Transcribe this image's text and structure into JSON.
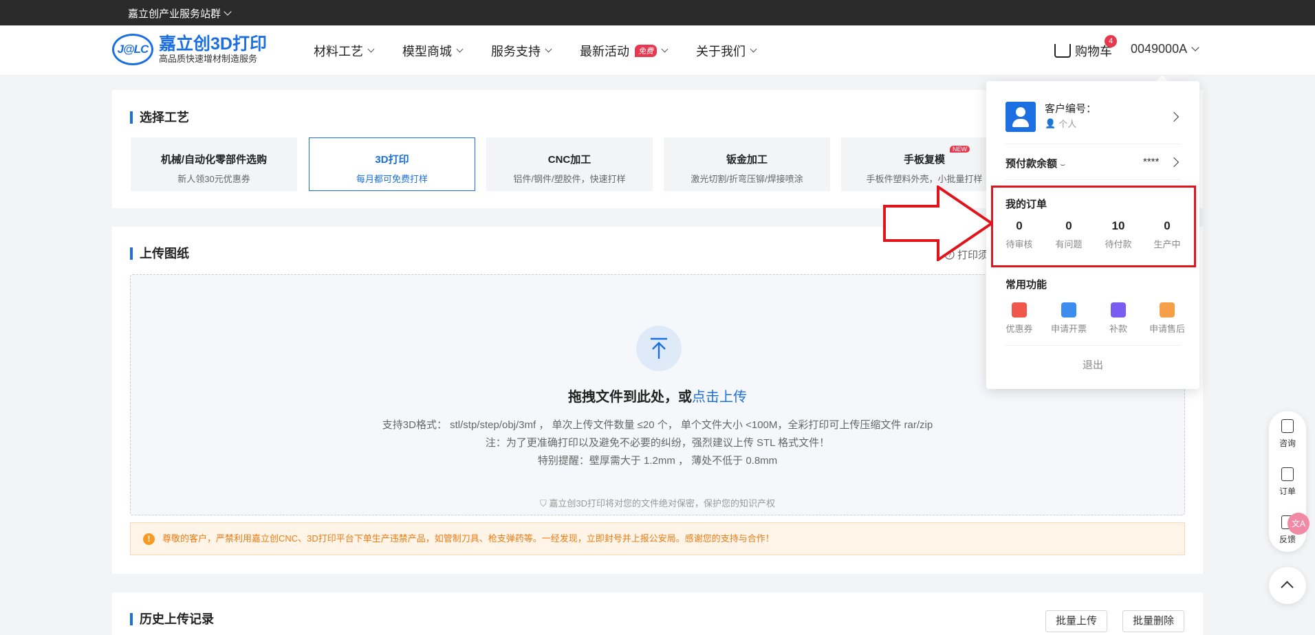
{
  "topbar": {
    "group_label": "嘉立创产业服务站群"
  },
  "header": {
    "logo_mark": "J@LC",
    "logo_name": "嘉立创3D打印",
    "logo_slogan": "高品质快速增材制造服务",
    "nav": [
      {
        "label": "材料工艺"
      },
      {
        "label": "模型商城"
      },
      {
        "label": "服务支持"
      },
      {
        "label": "最新活动",
        "badge": "免费"
      },
      {
        "label": "关于我们"
      }
    ],
    "cart_label": "购物车",
    "cart_count": "4",
    "account_label": "0049000A"
  },
  "process": {
    "title": "选择工艺",
    "options": [
      {
        "title": "机械/自动化零部件选购",
        "sub": "新人领30元优惠券"
      },
      {
        "title": "3D打印",
        "sub": "每月都可免费打样"
      },
      {
        "title": "CNC加工",
        "sub": "铝件/钢件/塑胶件，快速打样"
      },
      {
        "title": "钣金加工",
        "sub": "激光切割/折弯压铆/焊接喷涂"
      },
      {
        "title": "手板复模",
        "sub": "手板件塑料外壳，小批量打样",
        "badge": "NEW"
      }
    ]
  },
  "upload": {
    "title": "上传图纸",
    "help_link": "打印须",
    "drop_title": "拖拽文件到此处，或",
    "drop_link": "点击上传",
    "line1": "支持3D格式： stl/stp/step/obj/3mf ， 单次上传文件数量 ≤20 个， 单个文件大小 <100M，全彩打印可上传压缩文件 rar/zip",
    "line2": "注：为了更准确打印以及避免不必要的纠纷，强烈建议上传 STL 格式文件！",
    "line3": "特别提醒：壁厚需大于 1.2mm ， 薄处不低于 0.8mm",
    "secure_note": "嘉立创3D打印将对您的文件绝对保密，保护您的知识产权",
    "warning": "尊敬的客户，严禁利用嘉立创CNC、3D打印平台下单生产违禁产品，如管制刀具、枪支弹药等。一经发现，立即封号并上报公安局。感谢您的支持与合作！"
  },
  "history": {
    "title": "历史上传记录",
    "batch_upload": "批量上传",
    "batch_delete": "批量删除"
  },
  "panel": {
    "customer_label": "客户编号：",
    "customer_type": "个人",
    "balance_label": "预付款余额",
    "balance_value": "****",
    "orders_title": "我的订单",
    "orders": [
      {
        "count": "0",
        "label": "待审核"
      },
      {
        "count": "0",
        "label": "有问题"
      },
      {
        "count": "10",
        "label": "待付款"
      },
      {
        "count": "0",
        "label": "生产中"
      }
    ],
    "functions_title": "常用功能",
    "functions": [
      {
        "label": "优惠券",
        "icon": "coupon-icon",
        "color": "#f0564a"
      },
      {
        "label": "申请开票",
        "icon": "invoice-icon",
        "color": "#3d8cf0"
      },
      {
        "label": "补款",
        "icon": "payment-icon",
        "color": "#7a5cf0"
      },
      {
        "label": "申请售后",
        "icon": "aftersale-icon",
        "color": "#f5a048"
      }
    ],
    "logout": "退出"
  },
  "float": {
    "consult": "咨询",
    "orders": "订单",
    "feedback": "反馈",
    "translate": "文A"
  },
  "colors": {
    "brand": "#1b6fe0",
    "danger": "#e0151c",
    "warning": "#f07a12"
  }
}
